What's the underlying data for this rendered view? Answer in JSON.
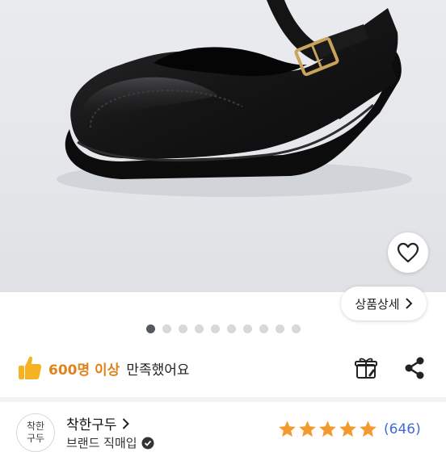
{
  "product": {
    "image_alt": "black mary jane shoe with gold buckle"
  },
  "wishlist": {
    "icon": "heart-outline-icon"
  },
  "detail_button": {
    "label": "상품상세",
    "icon": "chevron-right-icon"
  },
  "carousel": {
    "total": 10,
    "current": 1
  },
  "satisfaction": {
    "icon": "thumbs-up-icon",
    "highlight": "600명 이상",
    "text": "만족했어요"
  },
  "actions": {
    "gift_icon": "gift-icon",
    "share_icon": "share-icon"
  },
  "shop": {
    "avatar_line1": "착한",
    "avatar_line2": "구두",
    "name": "착한구두",
    "badge_label": "브랜드 직매입",
    "badge_icon": "verified-check-icon"
  },
  "rating": {
    "stars": 5,
    "review_count": "(646)"
  },
  "colors": {
    "accent": "#e0821a",
    "star": "#f39a2e",
    "link": "#4169d8",
    "dot_active": "#55585e",
    "dot_inactive": "#d7d8db"
  }
}
